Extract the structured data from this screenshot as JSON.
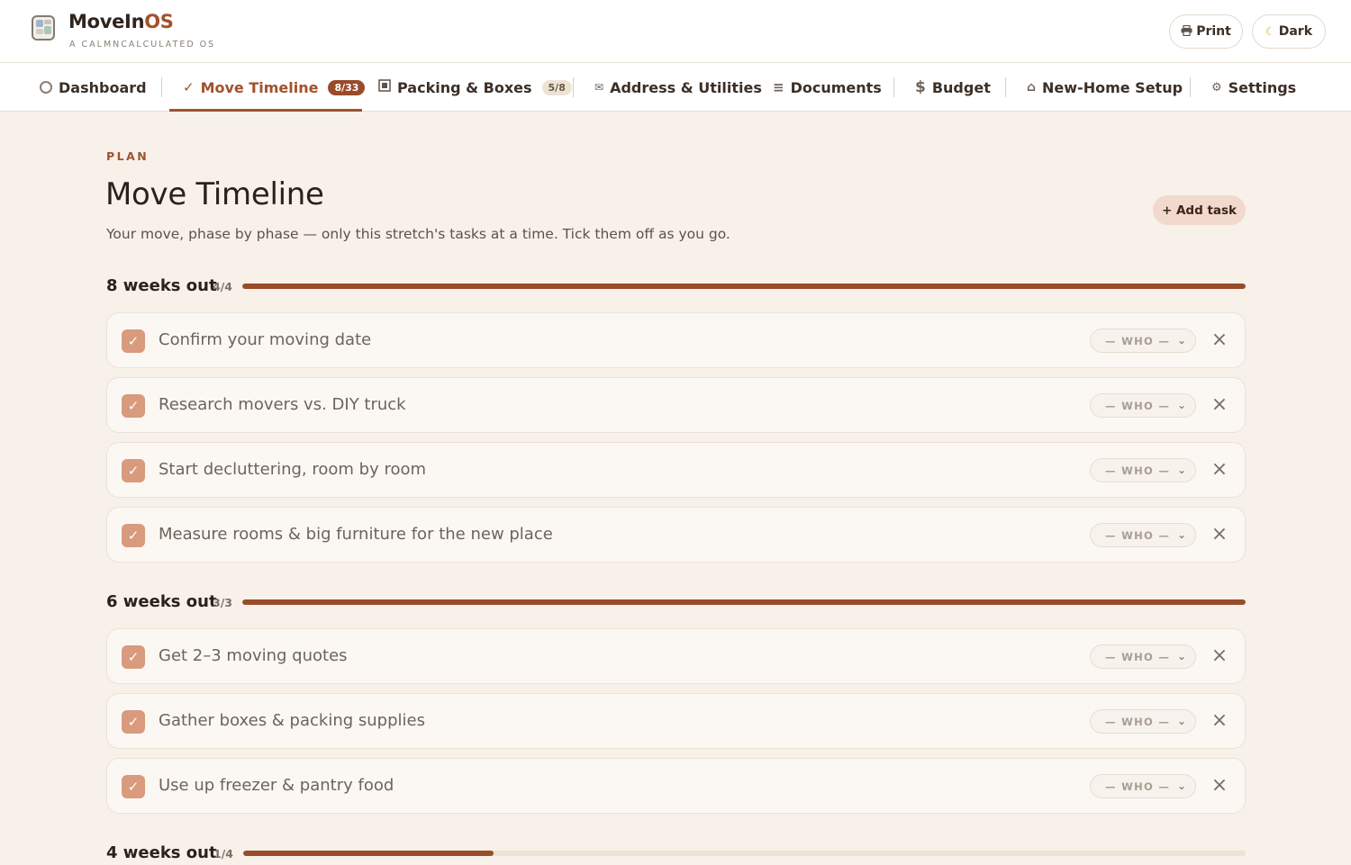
{
  "app": {
    "brand_part1": "MoveIn",
    "brand_part2": "OS",
    "tagline": "A CALMNCALCULATED OS",
    "print_label": "Print",
    "dark_label": "Dark",
    "icons": {
      "logo": "app-grid-icon",
      "print": "printer-icon",
      "dark": "moon-icon"
    }
  },
  "nav": {
    "tabs": [
      {
        "label": "Dashboard",
        "icon": "circle-icon",
        "badge": null
      },
      {
        "label": "Move Timeline",
        "icon": "check-icon",
        "badge": "8/33",
        "active": true
      },
      {
        "label": "Packing & Boxes",
        "icon": "box-icon",
        "badge": "5/8"
      },
      {
        "label": "Address & Utilities",
        "icon": "envelope-icon",
        "badge": null
      },
      {
        "label": "Documents",
        "icon": "lines-icon",
        "badge": null
      },
      {
        "label": "Budget",
        "icon": "dollar-icon",
        "badge": null
      },
      {
        "label": "New-Home Setup",
        "icon": "house-icon",
        "badge": null
      },
      {
        "label": "Settings",
        "icon": "gear-icon",
        "badge": null
      }
    ]
  },
  "main": {
    "eyebrow": "PLAN",
    "title": "Move Timeline",
    "subtitle": "Your move, phase by phase — only this stretch's tasks at a time. Tick them off as you go.",
    "add_task_label": "+ Add task",
    "who_placeholder": "— WHO —",
    "phases": [
      {
        "name": "8 weeks out",
        "count": "4/4",
        "progress": 1.0,
        "tasks": [
          {
            "label": "Confirm your moving date",
            "done": true
          },
          {
            "label": "Research movers vs. DIY truck",
            "done": true
          },
          {
            "label": "Start decluttering, room by room",
            "done": true
          },
          {
            "label": "Measure rooms & big furniture for the new place",
            "done": true
          }
        ]
      },
      {
        "name": "6 weeks out",
        "count": "3/3",
        "progress": 1.0,
        "tasks": [
          {
            "label": "Get 2–3 moving quotes",
            "done": true
          },
          {
            "label": "Gather boxes & packing supplies",
            "done": true
          },
          {
            "label": "Use up freezer & pantry food",
            "done": true
          }
        ]
      },
      {
        "name": "4 weeks out",
        "count": "1/4",
        "progress": 0.25,
        "tasks": []
      }
    ]
  },
  "colors": {
    "accent": "#a0522d",
    "progress_fill": "#9a4b2a",
    "progress_track": "#ede3d3",
    "checkbox": "#d99a7e",
    "background": "#f7f1e9"
  }
}
